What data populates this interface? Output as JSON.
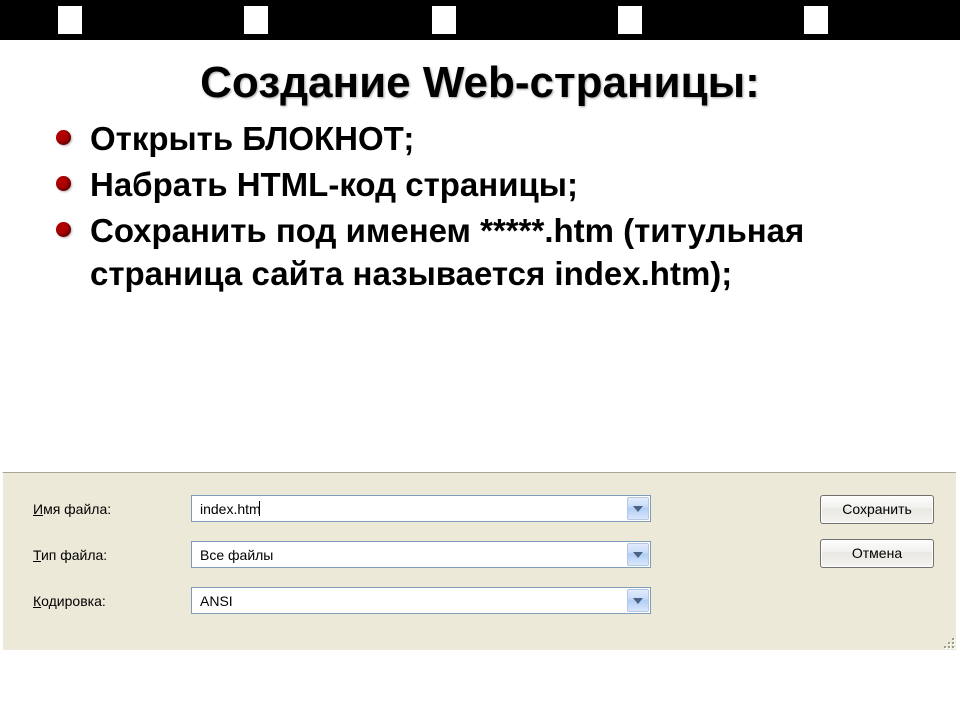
{
  "slide": {
    "title": "Создание Web-страницы:",
    "bullets": [
      "Открыть  БЛОКНОТ;",
      "Набрать HTML-код страницы;",
      "Сохранить под именем *****.htm (титульная страница сайта называется index.htm);"
    ]
  },
  "dialog": {
    "filename_label_pre": "Имя файла:",
    "filetype_label_pre_u": "Т",
    "filetype_label_post": "ип файла:",
    "encoding_label_pre_u": "К",
    "encoding_label_post": "одировка:",
    "filename_value": "index.htm",
    "filetype_value": "Все файлы",
    "encoding_value": "ANSI",
    "save_button": "Сохранить",
    "cancel_button": "Отмена"
  }
}
